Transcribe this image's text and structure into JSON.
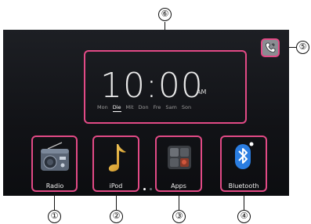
{
  "callouts": {
    "c1": "①",
    "c2": "②",
    "c3": "③",
    "c4": "④",
    "c5": "⑤",
    "c6": "⑥"
  },
  "clock": {
    "time": "10:00",
    "ampm": "AM",
    "days": [
      "Mon",
      "Die",
      "Mit",
      "Don",
      "Fre",
      "Sam",
      "Son"
    ],
    "active_day": "Die"
  },
  "apps": [
    {
      "label": "Radio",
      "icon": "radio-icon"
    },
    {
      "label": "iPod",
      "icon": "music-note-icon"
    },
    {
      "label": "Apps",
      "icon": "apps-icon"
    },
    {
      "label": "Bluetooth",
      "icon": "bluetooth-icon"
    }
  ],
  "page_indicator": {
    "pages": 2,
    "current": 1
  },
  "phone": {
    "icon": "phone-icon"
  },
  "colors": {
    "highlight": "#e24a86",
    "background": "#15161a",
    "bluetooth_blue": "#2a7de1"
  }
}
